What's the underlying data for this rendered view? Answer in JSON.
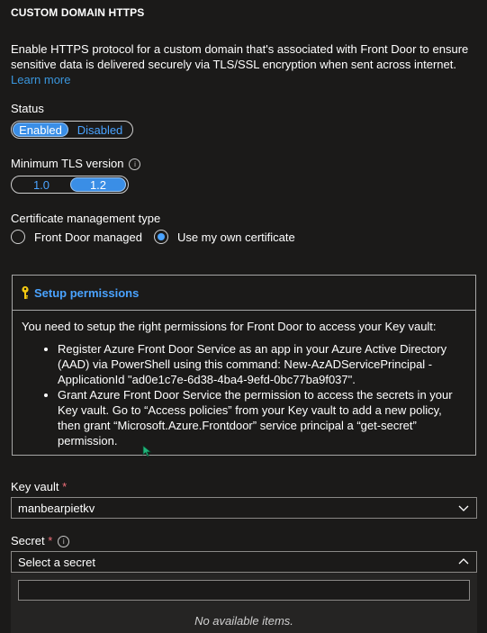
{
  "section": {
    "title": "CUSTOM DOMAIN HTTPS",
    "description": "Enable HTTPS protocol for a custom domain that's associated with Front Door to ensure sensitive data is delivered securely via TLS/SSL encryption when sent across internet.",
    "learn_more": "Learn more"
  },
  "status": {
    "label": "Status",
    "options": [
      "Enabled",
      "Disabled"
    ],
    "selected": "Enabled"
  },
  "tls": {
    "label": "Minimum TLS version",
    "info_icon": "i",
    "options": [
      "1.0",
      "1.2"
    ],
    "selected": "1.2"
  },
  "cert": {
    "label": "Certificate management type",
    "options": [
      "Front Door managed",
      "Use my own certificate"
    ],
    "selected": "Use my own certificate"
  },
  "permissions": {
    "title": "Setup permissions",
    "intro": "You need to setup the right permissions for Front Door to access your Key vault:",
    "bullets": [
      "Register Azure Front Door Service as an app in your Azure Active Directory (AAD) via PowerShell using this command: New-AzADServicePrincipal -ApplicationId \"ad0e1c7e-6d38-4ba4-9efd-0bc77ba9f037\".",
      "Grant Azure Front Door Service the permission to access the secrets in your Key vault. Go to “Access policies” from your Key vault to add a new policy, then grant “Microsoft.Azure.Frontdoor” service principal a “get-secret” permission."
    ]
  },
  "key_vault": {
    "label": "Key vault",
    "required_mark": "*",
    "value": "manbearpietkv"
  },
  "secret": {
    "label": "Secret",
    "required_mark": "*",
    "info_icon": "i",
    "placeholder": "Select a secret",
    "search_value": "",
    "empty_text": "No available items."
  },
  "colors": {
    "background": "#1b1a19",
    "accent": "#3a8ee6",
    "link": "#3a96dd",
    "required": "#f1707b",
    "key_icon": "#f2c811"
  }
}
